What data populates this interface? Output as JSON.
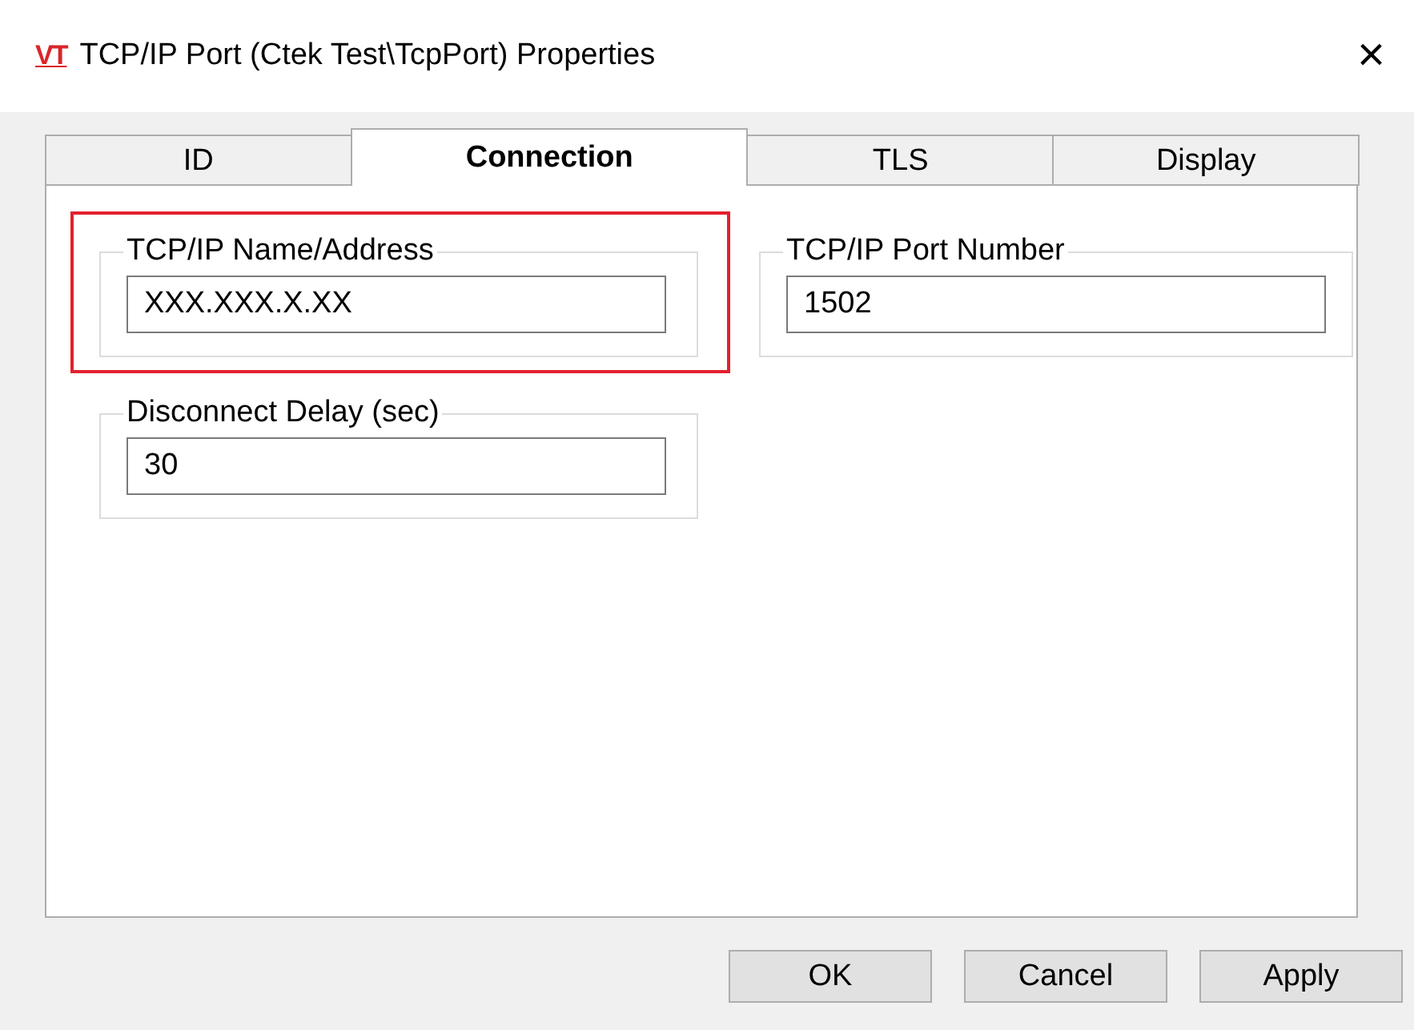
{
  "window": {
    "logo": "VT",
    "title": "TCP/IP Port (Ctek Test\\TcpPort) Properties",
    "close": "×"
  },
  "tabs": [
    {
      "label": "ID",
      "selected": false
    },
    {
      "label": "Connection",
      "selected": true
    },
    {
      "label": "TLS",
      "selected": false
    },
    {
      "label": "Display",
      "selected": false
    }
  ],
  "groups": [
    {
      "label": "TCP/IP Name/Address",
      "value": "XXX.XXX.X.XX",
      "highlighted": true
    },
    {
      "label": "TCP/IP Port Number",
      "value": "1502",
      "highlighted": false
    },
    {
      "label": "Disconnect Delay (sec)",
      "value": "30",
      "highlighted": false
    }
  ],
  "buttons": [
    "OK",
    "Cancel",
    "Apply"
  ]
}
